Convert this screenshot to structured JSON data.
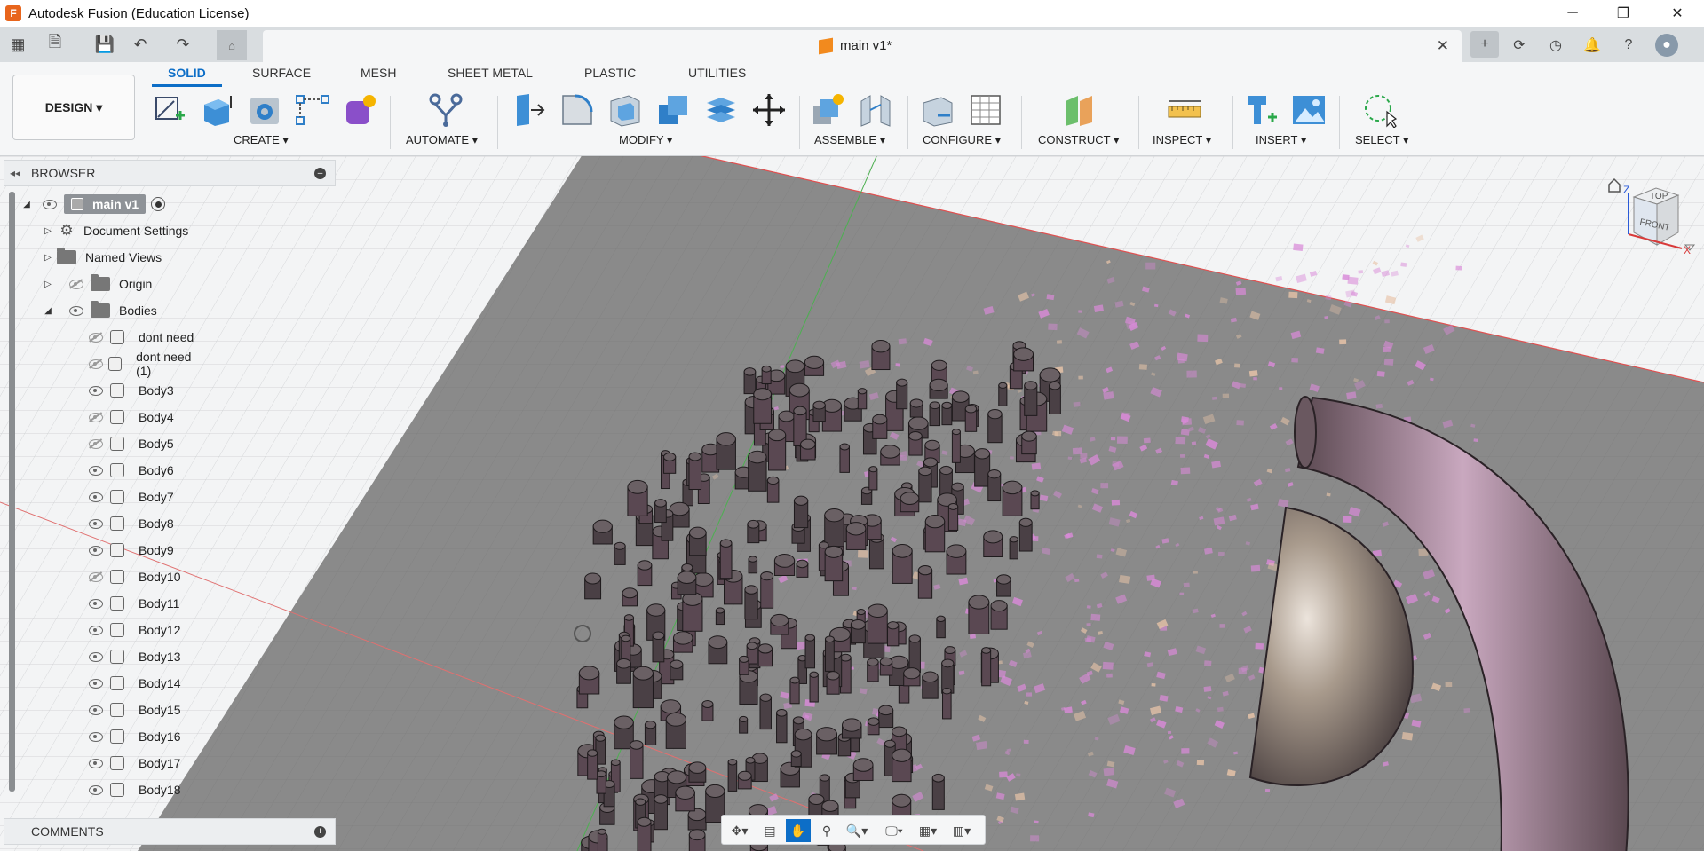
{
  "window": {
    "title": "Autodesk Fusion (Education License)",
    "logo_letter": "F",
    "controls": [
      "minimize",
      "restore",
      "close"
    ]
  },
  "document_tab": {
    "title": "main v1*"
  },
  "toolbar": {
    "workspace": "DESIGN ▾",
    "tabs": [
      "SOLID",
      "SURFACE",
      "MESH",
      "SHEET METAL",
      "PLASTIC",
      "UTILITIES"
    ],
    "active_tab": "SOLID",
    "groups": [
      "CREATE ▾",
      "AUTOMATE ▾",
      "MODIFY ▾",
      "ASSEMBLE ▾",
      "CONFIGURE ▾",
      "CONSTRUCT ▾",
      "INSPECT ▾",
      "INSERT ▾",
      "SELECT ▾"
    ]
  },
  "browser": {
    "title": "BROWSER",
    "root": "main v1",
    "items": [
      {
        "label": "Document Settings"
      },
      {
        "label": "Named Views"
      },
      {
        "label": "Origin"
      },
      {
        "label": "Bodies"
      }
    ],
    "bodies": [
      {
        "label": "dont need",
        "visible": false
      },
      {
        "label": "dont need (1)",
        "visible": false
      },
      {
        "label": "Body3",
        "visible": true
      },
      {
        "label": "Body4",
        "visible": false
      },
      {
        "label": "Body5",
        "visible": false
      },
      {
        "label": "Body6",
        "visible": true
      },
      {
        "label": "Body7",
        "visible": true
      },
      {
        "label": "Body8",
        "visible": true
      },
      {
        "label": "Body9",
        "visible": true
      },
      {
        "label": "Body10",
        "visible": false
      },
      {
        "label": "Body11",
        "visible": true
      },
      {
        "label": "Body12",
        "visible": true
      },
      {
        "label": "Body13",
        "visible": true
      },
      {
        "label": "Body14",
        "visible": true
      },
      {
        "label": "Body15",
        "visible": true
      },
      {
        "label": "Body16",
        "visible": true
      },
      {
        "label": "Body17",
        "visible": true
      },
      {
        "label": "Body18",
        "visible": true
      }
    ]
  },
  "comments": {
    "title": "COMMENTS"
  },
  "viewcube": {
    "top": "TOP",
    "front": "FRONT",
    "axis_x": "X",
    "axis_z": "Z"
  },
  "colors": {
    "accent": "#0d6ec7",
    "ground": "#8c8c8c",
    "pillars": "#4a4045",
    "particles": "#d98ad8"
  }
}
